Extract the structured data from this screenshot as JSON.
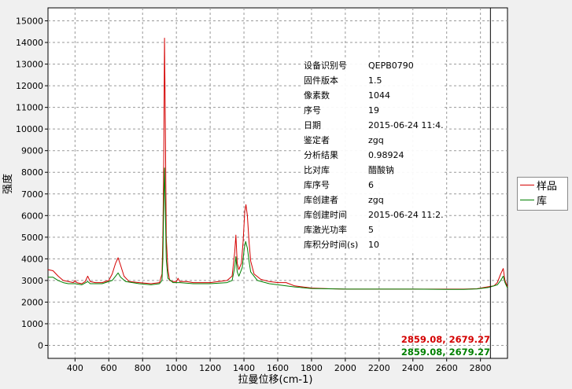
{
  "chart_data": {
    "type": "line",
    "title": "",
    "xlabel": "拉曼位移(cm-1)",
    "ylabel": "强度",
    "xlim": [
      240,
      2960
    ],
    "ylim": [
      -600,
      15600
    ],
    "x_ticks": [
      400,
      600,
      800,
      1000,
      1200,
      1400,
      1600,
      1800,
      2000,
      2200,
      2400,
      2600,
      2800
    ],
    "y_ticks": [
      0,
      1000,
      2000,
      3000,
      4000,
      5000,
      6000,
      7000,
      8000,
      9000,
      10000,
      11000,
      12000,
      13000,
      14000,
      15000
    ],
    "grid": true,
    "legend_position": "right",
    "cursor_x": 2859.08,
    "series": [
      {
        "name": "样品",
        "color": "#d40000",
        "points": [
          [
            240,
            3500
          ],
          [
            270,
            3450
          ],
          [
            300,
            3200
          ],
          [
            330,
            3000
          ],
          [
            360,
            2950
          ],
          [
            390,
            2900
          ],
          [
            400,
            3000
          ],
          [
            410,
            2900
          ],
          [
            440,
            2850
          ],
          [
            460,
            2950
          ],
          [
            475,
            3200
          ],
          [
            490,
            2950
          ],
          [
            520,
            2900
          ],
          [
            560,
            2900
          ],
          [
            600,
            3000
          ],
          [
            620,
            3300
          ],
          [
            640,
            3800
          ],
          [
            655,
            4050
          ],
          [
            670,
            3700
          ],
          [
            690,
            3200
          ],
          [
            720,
            2950
          ],
          [
            780,
            2900
          ],
          [
            850,
            2850
          ],
          [
            900,
            2900
          ],
          [
            915,
            3300
          ],
          [
            920,
            5000
          ],
          [
            925,
            8500
          ],
          [
            930,
            14200
          ],
          [
            935,
            10000
          ],
          [
            940,
            5000
          ],
          [
            950,
            3500
          ],
          [
            960,
            3000
          ],
          [
            980,
            2950
          ],
          [
            1000,
            2950
          ],
          [
            1010,
            3100
          ],
          [
            1020,
            2950
          ],
          [
            1060,
            2950
          ],
          [
            1100,
            2900
          ],
          [
            1150,
            2900
          ],
          [
            1200,
            2900
          ],
          [
            1250,
            2950
          ],
          [
            1300,
            3000
          ],
          [
            1330,
            3200
          ],
          [
            1345,
            4300
          ],
          [
            1352,
            5100
          ],
          [
            1360,
            3800
          ],
          [
            1370,
            3500
          ],
          [
            1385,
            3800
          ],
          [
            1395,
            4800
          ],
          [
            1405,
            6200
          ],
          [
            1412,
            6500
          ],
          [
            1420,
            6000
          ],
          [
            1430,
            4800
          ],
          [
            1440,
            3900
          ],
          [
            1460,
            3300
          ],
          [
            1500,
            3050
          ],
          [
            1550,
            2950
          ],
          [
            1600,
            2900
          ],
          [
            1650,
            2900
          ],
          [
            1700,
            2750
          ],
          [
            1800,
            2650
          ],
          [
            1900,
            2620
          ],
          [
            2000,
            2600
          ],
          [
            2200,
            2600
          ],
          [
            2400,
            2600
          ],
          [
            2600,
            2600
          ],
          [
            2700,
            2600
          ],
          [
            2780,
            2620
          ],
          [
            2840,
            2700
          ],
          [
            2880,
            2750
          ],
          [
            2900,
            2900
          ],
          [
            2920,
            3300
          ],
          [
            2935,
            3550
          ],
          [
            2945,
            3000
          ],
          [
            2960,
            2700
          ]
        ]
      },
      {
        "name": "库",
        "color": "#008000",
        "points": [
          [
            240,
            3150
          ],
          [
            270,
            3150
          ],
          [
            300,
            3000
          ],
          [
            330,
            2900
          ],
          [
            360,
            2850
          ],
          [
            390,
            2850
          ],
          [
            400,
            2850
          ],
          [
            440,
            2800
          ],
          [
            475,
            2950
          ],
          [
            490,
            2850
          ],
          [
            560,
            2850
          ],
          [
            620,
            3000
          ],
          [
            640,
            3200
          ],
          [
            655,
            3350
          ],
          [
            670,
            3150
          ],
          [
            700,
            2950
          ],
          [
            780,
            2850
          ],
          [
            850,
            2800
          ],
          [
            900,
            2850
          ],
          [
            915,
            3000
          ],
          [
            920,
            4000
          ],
          [
            925,
            6500
          ],
          [
            930,
            8200
          ],
          [
            935,
            6200
          ],
          [
            940,
            4000
          ],
          [
            950,
            3100
          ],
          [
            980,
            2900
          ],
          [
            1020,
            2900
          ],
          [
            1100,
            2850
          ],
          [
            1200,
            2850
          ],
          [
            1300,
            2900
          ],
          [
            1330,
            3000
          ],
          [
            1345,
            3600
          ],
          [
            1352,
            4100
          ],
          [
            1360,
            3400
          ],
          [
            1370,
            3200
          ],
          [
            1390,
            3600
          ],
          [
            1402,
            4500
          ],
          [
            1410,
            4800
          ],
          [
            1420,
            4500
          ],
          [
            1430,
            3900
          ],
          [
            1440,
            3400
          ],
          [
            1480,
            3000
          ],
          [
            1550,
            2850
          ],
          [
            1600,
            2800
          ],
          [
            1700,
            2700
          ],
          [
            1800,
            2630
          ],
          [
            2000,
            2600
          ],
          [
            2200,
            2600
          ],
          [
            2400,
            2600
          ],
          [
            2600,
            2590
          ],
          [
            2700,
            2590
          ],
          [
            2780,
            2610
          ],
          [
            2850,
            2680
          ],
          [
            2900,
            2800
          ],
          [
            2920,
            3000
          ],
          [
            2935,
            3200
          ],
          [
            2945,
            2900
          ],
          [
            2960,
            2650
          ]
        ]
      }
    ]
  },
  "info_table": [
    {
      "key": "设备识别号",
      "value": "QEPB0790"
    },
    {
      "key": "固件版本",
      "value": "1.5"
    },
    {
      "key": "像素数",
      "value": "1044"
    },
    {
      "key": "序号",
      "value": "19"
    },
    {
      "key": "日期",
      "value": "2015-06-24 11:4..."
    },
    {
      "key": "鉴定者",
      "value": "zgq"
    },
    {
      "key": "分析结果",
      "value": "0.98924"
    },
    {
      "key": "比对库",
      "value": "醋酸钠"
    },
    {
      "key": "库序号",
      "value": "6"
    },
    {
      "key": "库创建者",
      "value": "zgq"
    },
    {
      "key": "库创建时间",
      "value": "2015-06-24 11:2..."
    },
    {
      "key": "库激光功率",
      "value": "5"
    },
    {
      "key": "库积分时间(s)",
      "value": "10"
    }
  ],
  "legend": [
    {
      "label": "样品",
      "color": "#d40000"
    },
    {
      "label": "库",
      "color": "#008000"
    }
  ],
  "readouts": [
    {
      "text": "2859.08, 2679.27",
      "color": "#d40000"
    },
    {
      "text": "2859.08, 2679.27",
      "color": "#008000"
    }
  ]
}
